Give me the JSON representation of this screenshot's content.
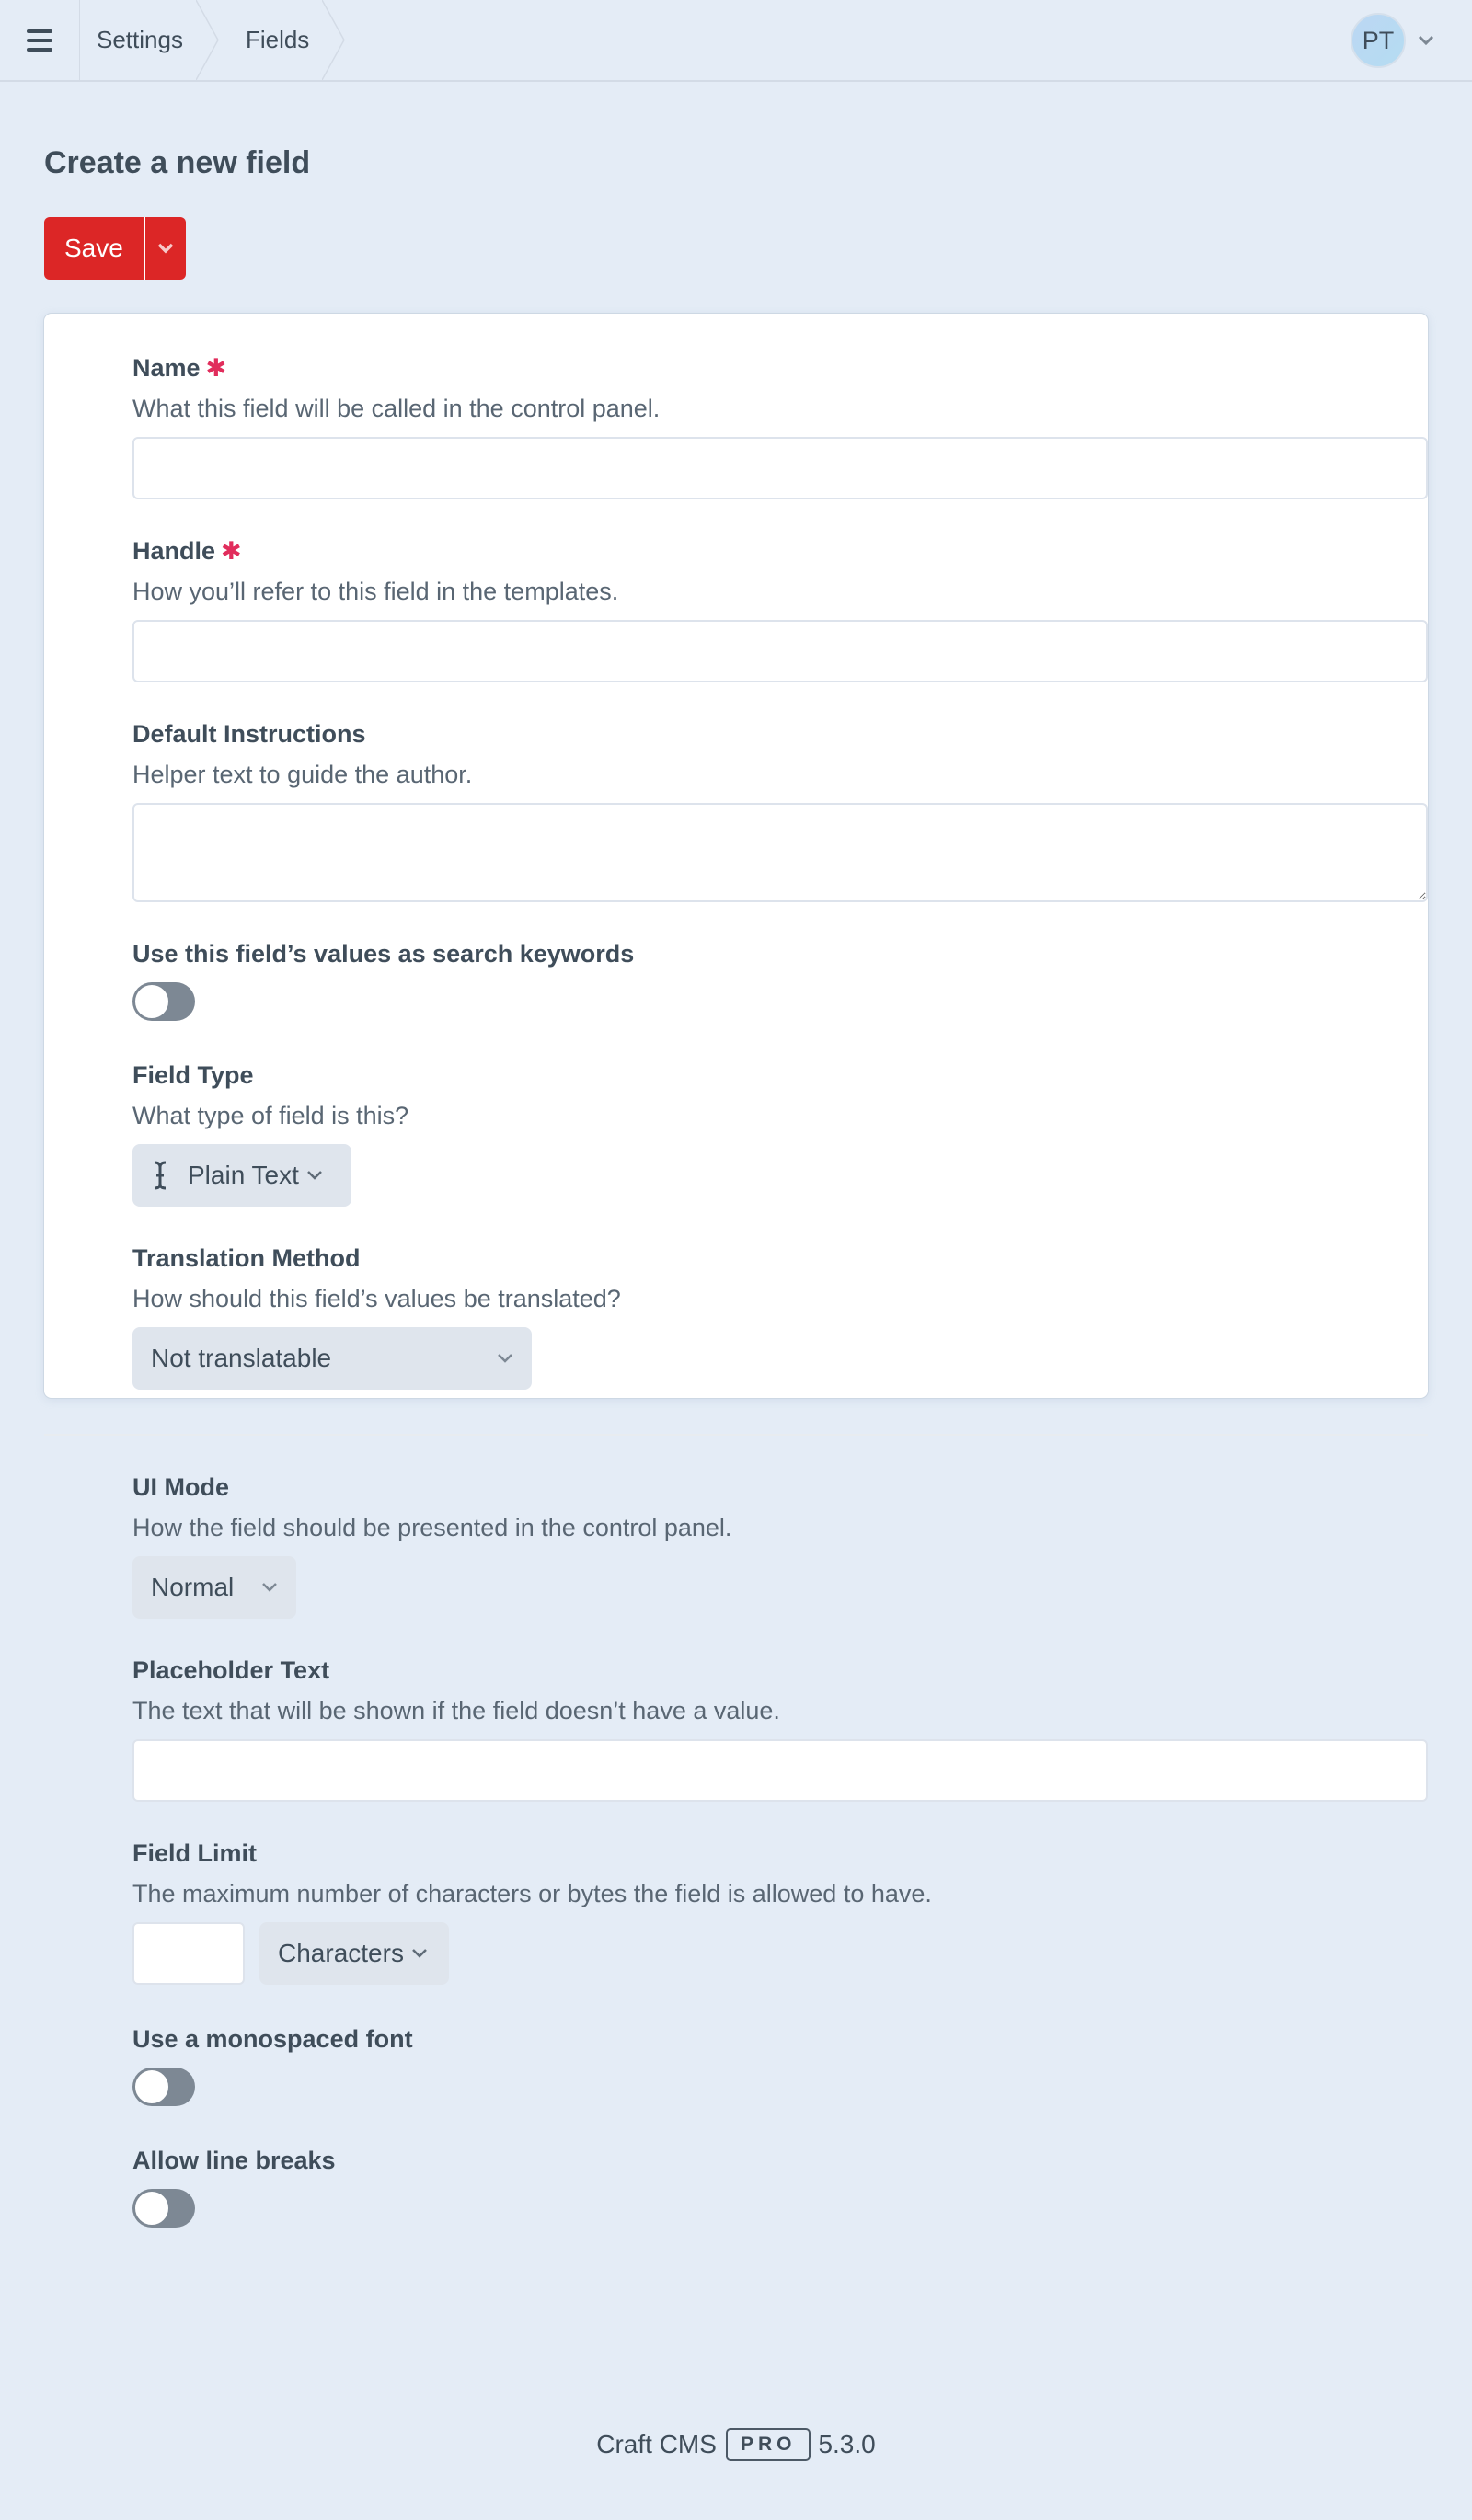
{
  "header": {
    "menu_icon": "hamburger-icon",
    "breadcrumbs": [
      {
        "label": "Settings"
      },
      {
        "label": "Fields"
      }
    ],
    "user": {
      "initials": "PT",
      "menu_icon": "chevron-down-icon"
    }
  },
  "page": {
    "title": "Create a new field",
    "save_label": "Save",
    "save_menu_icon": "chevron-down-icon"
  },
  "form": {
    "name": {
      "label": "Name",
      "required": true,
      "required_marker": "✱",
      "instructions": "What this field will be called in the control panel.",
      "value": "",
      "placeholder": ""
    },
    "handle": {
      "label": "Handle",
      "required": true,
      "required_marker": "✱",
      "instructions": "How you’ll refer to this field in the templates.",
      "value": "",
      "placeholder": ""
    },
    "default_instructions": {
      "label": "Default Instructions",
      "instructions": "Helper text to guide the author.",
      "value": ""
    },
    "search_keywords": {
      "label": "Use this field’s values as search keywords",
      "on": false
    },
    "field_type": {
      "label": "Field Type",
      "instructions": "What type of field is this?",
      "selected": "Plain Text",
      "icon": "text-cursor-icon"
    },
    "translation_method": {
      "label": "Translation Method",
      "instructions": "How should this field’s values be translated?",
      "selected": "Not translatable"
    },
    "ui_mode": {
      "label": "UI Mode",
      "instructions": "How the field should be presented in the control panel.",
      "selected": "Normal"
    },
    "placeholder_text": {
      "label": "Placeholder Text",
      "instructions": "The text that will be shown if the field doesn’t have a value.",
      "value": ""
    },
    "field_limit": {
      "label": "Field Limit",
      "instructions": "The maximum number of characters or bytes the field is allowed to have.",
      "value": "",
      "unit": "Characters"
    },
    "monospaced": {
      "label": "Use a monospaced font",
      "on": false
    },
    "line_breaks": {
      "label": "Allow line breaks",
      "on": false
    }
  },
  "footer": {
    "product": "Craft CMS",
    "edition": "PRO",
    "version": "5.3.0"
  },
  "colors": {
    "accent_red": "#dc2626",
    "required_red": "#e12d5c",
    "background": "#e4ecf6",
    "text": "#3f4d5a"
  }
}
